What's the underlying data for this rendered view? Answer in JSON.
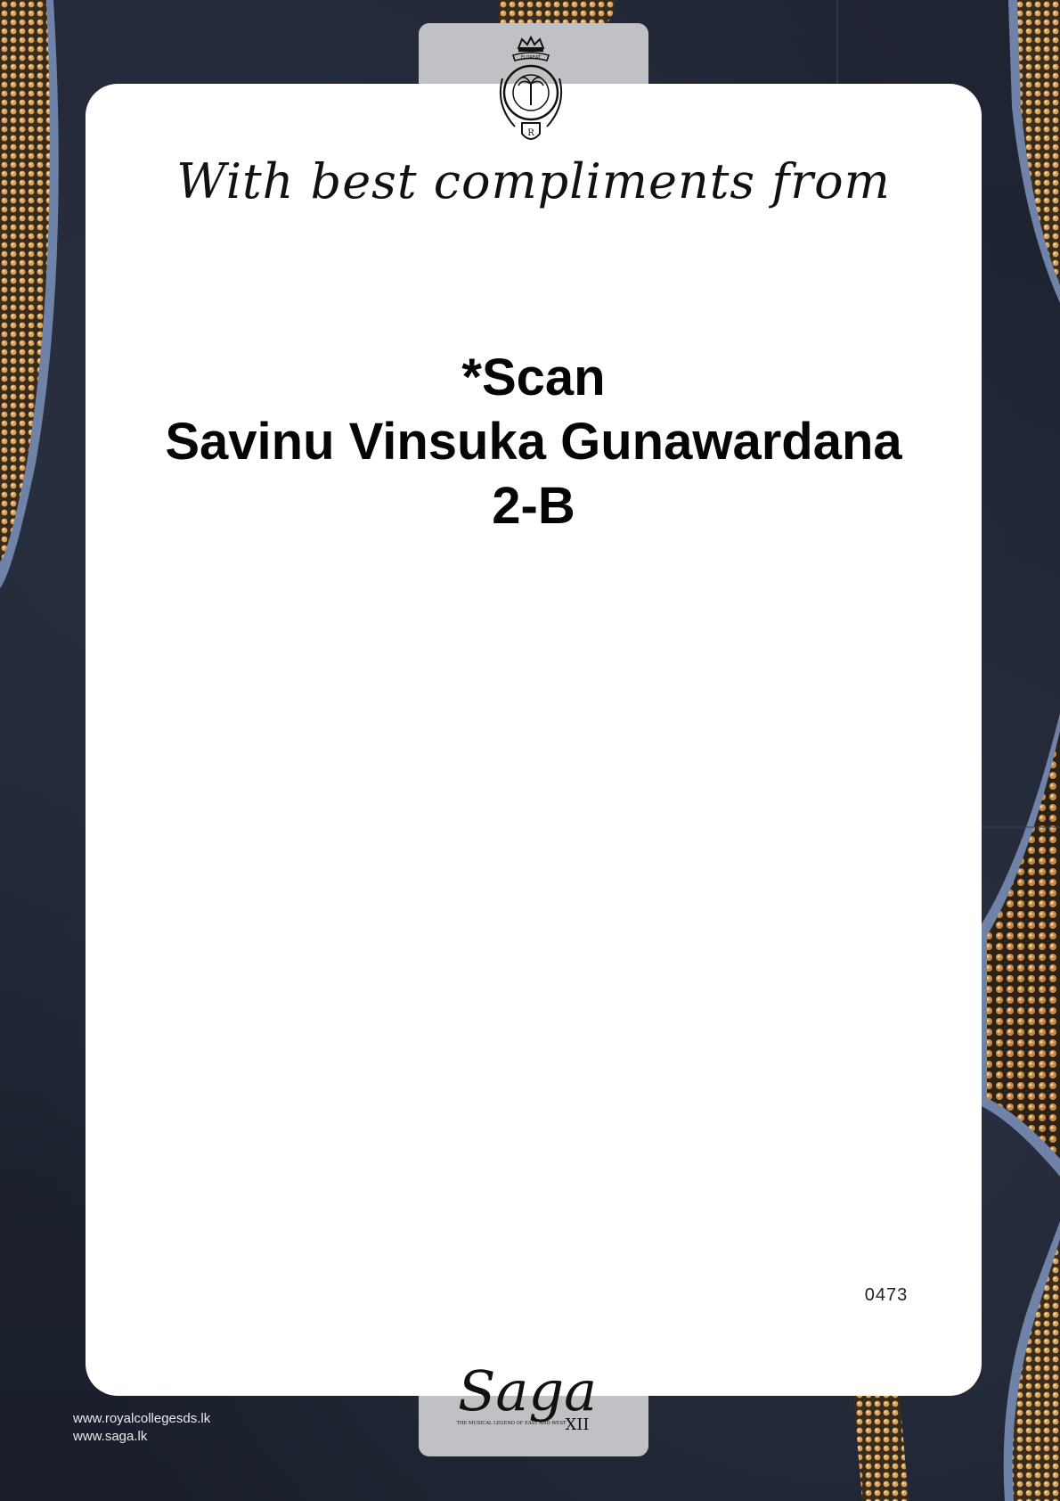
{
  "document": {
    "greeting": "With best compliments from",
    "lines": [
      "*Scan",
      "Savinu Vinsuka Gunawardana",
      "2-B"
    ],
    "serial": "0473"
  },
  "crest": {
    "motto_top": "FLOREAT",
    "motto_ring": "DISCE AUT DISCEDE",
    "icon": "school-crest-icon"
  },
  "logo": {
    "name": "Saga",
    "numeral": "XII",
    "tagline": "THE MUSICAL LEGEND OF EAST AND WEST"
  },
  "footer": {
    "websites": [
      "www.royalcollegesds.lk",
      "www.saga.lk"
    ]
  },
  "colors": {
    "background": "#1d2230",
    "card": "#ffffff",
    "tab": "#bfc1c4",
    "sequin_gold": "#d9a25a",
    "ribbon_edge": "#6f82a8"
  }
}
